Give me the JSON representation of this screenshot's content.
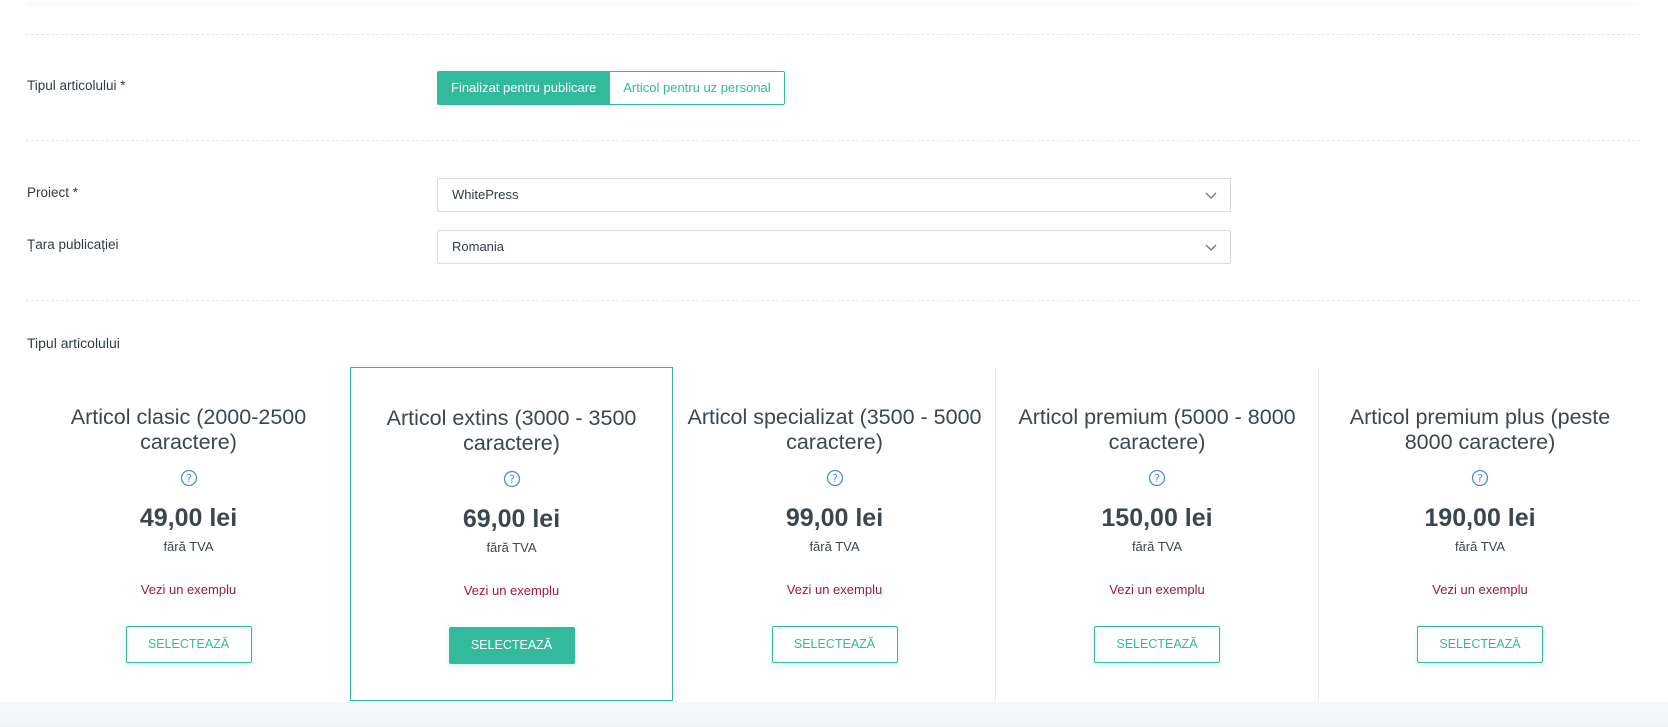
{
  "form": {
    "article_type_label": "Tipul articolului *",
    "toggle": {
      "option_active": "Finalizat pentru publicare",
      "option_inactive": "Articol pentru uz personal"
    },
    "project_label": "Proiect *",
    "project_value": "WhitePress",
    "country_label": "Țara publicației",
    "country_value": "Romania"
  },
  "packages": {
    "section_title": "Tipul articolului",
    "items": [
      {
        "title": "Articol clasic (2000-2500 caractere)",
        "price": "49,00 lei",
        "vat": "fără TVA",
        "example": "Vezi un exemplu",
        "button": "SELECTEAZĂ",
        "selected": false
      },
      {
        "title": "Articol extins (3000 - 3500 caractere)",
        "price": "69,00 lei",
        "vat": "fără TVA",
        "example": "Vezi un exemplu",
        "button": "SELECTEAZĂ",
        "selected": true
      },
      {
        "title": "Articol specializat (3500 - 5000 caractere)",
        "price": "99,00 lei",
        "vat": "fără TVA",
        "example": "Vezi un exemplu",
        "button": "SELECTEAZĂ",
        "selected": false
      },
      {
        "title": "Articol premium (5000 - 8000 caractere)",
        "price": "150,00 lei",
        "vat": "fără TVA",
        "example": "Vezi un exemplu",
        "button": "SELECTEAZĂ",
        "selected": false
      },
      {
        "title": "Articol premium plus (peste 8000 caractere)",
        "price": "190,00 lei",
        "vat": "fără TVA",
        "example": "Vezi un exemplu",
        "button": "SELECTEAZĂ",
        "selected": false
      }
    ]
  },
  "colors": {
    "accent": "#33b99b",
    "link": "#a1173f",
    "text": "#3a4652",
    "help_icon": "#4a90d9"
  },
  "icons": {
    "select_arrow": "chevron-down-icon",
    "help": "help-circle-icon"
  }
}
